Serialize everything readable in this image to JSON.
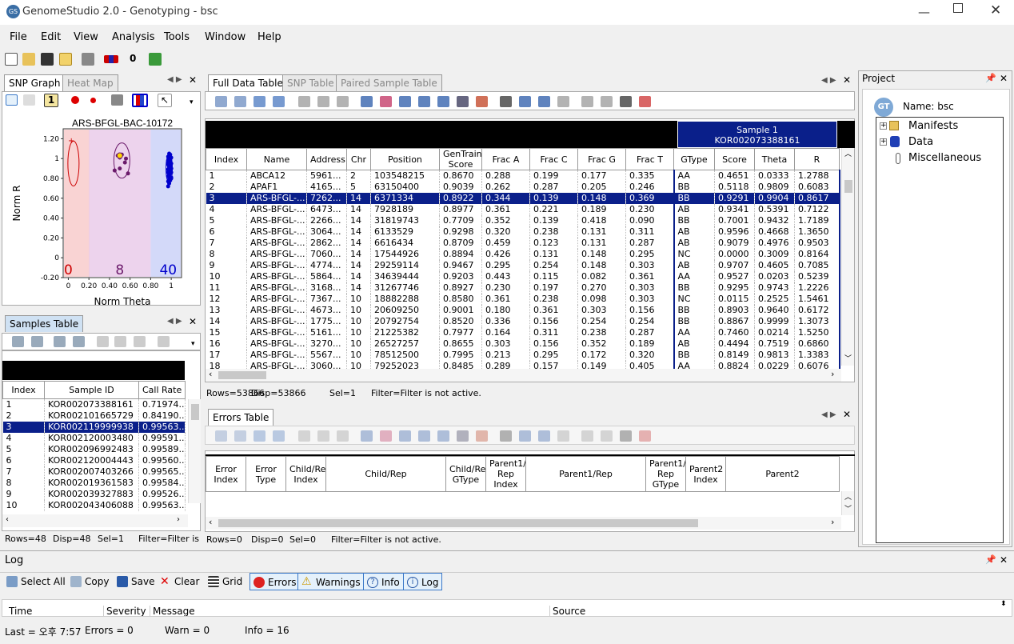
{
  "app": {
    "title": "GenomeStudio 2.0 - Genotyping - bsc",
    "logo": "GS"
  },
  "menu": [
    "File",
    "Edit",
    "View",
    "Analysis",
    "Tools",
    "Window",
    "Help"
  ],
  "toolbar_zero": "0",
  "snp_panel": {
    "tabs": [
      "SNP Graph",
      "Heat Map"
    ],
    "one": "1",
    "chart_title": "ARS-BFGL-BAC-10172",
    "xlabel": "Norm Theta",
    "ylabel": "Norm R",
    "counts": [
      "0",
      "8",
      "40"
    ]
  },
  "chart_data": {
    "type": "scatter",
    "title": "ARS-BFGL-BAC-10172",
    "xlabel": "Norm Theta",
    "ylabel": "Norm R",
    "ylim": [
      -0.2,
      1.3
    ],
    "xlim": [
      -0.05,
      1.1
    ],
    "xticks": [
      "0",
      "0.20",
      "0.40",
      "0.60",
      "0.80",
      "1"
    ],
    "yticks": [
      "1.20",
      "1",
      "0.80",
      "0.60",
      "0.40",
      "0.20",
      "0",
      "-0.20"
    ],
    "cluster_counts": {
      "AA": 0,
      "AB": 8,
      "BB": 40
    },
    "series": [
      {
        "name": "AB",
        "x": [
          0.48,
          0.5,
          0.52,
          0.55,
          0.58,
          0.45,
          0.56,
          0.5
        ],
        "y": [
          1.03,
          1.01,
          1.04,
          0.96,
          0.85,
          0.88,
          1.0,
          0.9
        ]
      },
      {
        "name": "BB",
        "x": [
          0.97,
          0.98,
          0.99,
          1.0,
          0.97,
          0.98,
          0.99,
          1.0,
          0.98,
          0.99,
          0.97,
          1.0,
          0.98,
          0.99,
          0.98,
          0.97,
          1.0,
          0.99,
          0.98,
          0.97,
          0.99,
          0.98,
          1.0,
          0.97,
          0.98,
          0.99,
          0.98,
          0.97,
          0.99,
          1.0,
          0.98,
          0.99,
          0.97,
          0.98,
          0.99,
          1.0,
          0.98,
          0.97,
          0.99,
          0.98
        ],
        "y": [
          0.72,
          0.75,
          0.78,
          0.8,
          0.82,
          0.84,
          0.85,
          0.86,
          0.87,
          0.88,
          0.89,
          0.9,
          0.91,
          0.92,
          0.93,
          0.94,
          0.95,
          0.96,
          0.97,
          0.98,
          0.99,
          1.0,
          1.01,
          1.02,
          1.03,
          1.04,
          0.83,
          0.86,
          0.88,
          0.9,
          0.92,
          0.94,
          0.96,
          0.98,
          1.0,
          0.81,
          0.79,
          0.77,
          0.95,
          1.05
        ]
      }
    ]
  },
  "samples_panel": {
    "tab": "Samples Table",
    "columns": [
      "Index",
      "Sample ID",
      "Call Rate"
    ],
    "rows": [
      [
        "1",
        "KOR002073388161",
        "0.71974..."
      ],
      [
        "2",
        "KOR002101665729",
        "0.84190..."
      ],
      [
        "3",
        "KOR002119999938",
        "0.99563..."
      ],
      [
        "4",
        "KOR002120003480",
        "0.99591..."
      ],
      [
        "5",
        "KOR002096992483",
        "0.99589..."
      ],
      [
        "6",
        "KOR002120004443",
        "0.99560..."
      ],
      [
        "7",
        "KOR002007403266",
        "0.99565..."
      ],
      [
        "8",
        "KOR002019361583",
        "0.99584..."
      ],
      [
        "9",
        "KOR002039327883",
        "0.99526..."
      ],
      [
        "10",
        "KOR002043406088",
        "0.99563..."
      ]
    ],
    "status": [
      "Rows=48",
      "Disp=48",
      "Sel=1",
      "Filter=Filter is not"
    ]
  },
  "full_panel": {
    "tabs": [
      "Full Data Table",
      "SNP Table",
      "Paired Sample Table"
    ],
    "sample_header": "Sample 1",
    "sample_id": "KOR002073388161",
    "columns": [
      "Index",
      "Name",
      "Address",
      "Chr",
      "Position",
      "GenTrain Score",
      "Frac A",
      "Frac C",
      "Frac G",
      "Frac T",
      "GType",
      "Score",
      "Theta",
      "R"
    ],
    "rows": [
      [
        "1",
        "ABCA12",
        "5961...",
        "2",
        "103548215",
        "0.8670",
        "0.288",
        "0.199",
        "0.177",
        "0.335",
        "AA",
        "0.4651",
        "0.0333",
        "1.2788"
      ],
      [
        "2",
        "APAF1",
        "4165...",
        "5",
        "63150400",
        "0.9039",
        "0.262",
        "0.287",
        "0.205",
        "0.246",
        "BB",
        "0.5118",
        "0.9809",
        "0.6083"
      ],
      [
        "3",
        "ARS-BFGL-...",
        "7262...",
        "14",
        "6371334",
        "0.8922",
        "0.344",
        "0.139",
        "0.148",
        "0.369",
        "BB",
        "0.9291",
        "0.9904",
        "0.8617"
      ],
      [
        "4",
        "ARS-BFGL-...",
        "6473...",
        "14",
        "7928189",
        "0.8977",
        "0.361",
        "0.221",
        "0.189",
        "0.230",
        "AB",
        "0.9341",
        "0.5391",
        "0.7122"
      ],
      [
        "5",
        "ARS-BFGL-...",
        "2266...",
        "14",
        "31819743",
        "0.7709",
        "0.352",
        "0.139",
        "0.418",
        "0.090",
        "BB",
        "0.7001",
        "0.9432",
        "1.7189"
      ],
      [
        "6",
        "ARS-BFGL-...",
        "3064...",
        "14",
        "6133529",
        "0.9298",
        "0.320",
        "0.238",
        "0.131",
        "0.311",
        "AB",
        "0.9596",
        "0.4668",
        "1.3650"
      ],
      [
        "7",
        "ARS-BFGL-...",
        "2862...",
        "14",
        "6616434",
        "0.8709",
        "0.459",
        "0.123",
        "0.131",
        "0.287",
        "AB",
        "0.9079",
        "0.4976",
        "0.9503"
      ],
      [
        "8",
        "ARS-BFGL-...",
        "7060...",
        "14",
        "17544926",
        "0.8894",
        "0.426",
        "0.131",
        "0.148",
        "0.295",
        "NC",
        "0.0000",
        "0.3009",
        "0.8164"
      ],
      [
        "9",
        "ARS-BFGL-...",
        "4774...",
        "14",
        "29259114",
        "0.9467",
        "0.295",
        "0.254",
        "0.148",
        "0.303",
        "AB",
        "0.9707",
        "0.4605",
        "0.7085"
      ],
      [
        "10",
        "ARS-BFGL-...",
        "5864...",
        "14",
        "34639444",
        "0.9203",
        "0.443",
        "0.115",
        "0.082",
        "0.361",
        "AA",
        "0.9527",
        "0.0203",
        "0.5239"
      ],
      [
        "11",
        "ARS-BFGL-...",
        "3168...",
        "14",
        "31267746",
        "0.8927",
        "0.230",
        "0.197",
        "0.270",
        "0.303",
        "BB",
        "0.9295",
        "0.9743",
        "1.2226"
      ],
      [
        "12",
        "ARS-BFGL-...",
        "7367...",
        "10",
        "18882288",
        "0.8580",
        "0.361",
        "0.238",
        "0.098",
        "0.303",
        "NC",
        "0.0115",
        "0.2525",
        "1.5461"
      ],
      [
        "13",
        "ARS-BFGL-...",
        "4673...",
        "10",
        "20609250",
        "0.9001",
        "0.180",
        "0.361",
        "0.303",
        "0.156",
        "BB",
        "0.8903",
        "0.9640",
        "0.6172"
      ],
      [
        "14",
        "ARS-BFGL-...",
        "1775...",
        "10",
        "20792754",
        "0.8520",
        "0.336",
        "0.156",
        "0.254",
        "0.254",
        "BB",
        "0.8867",
        "0.9999",
        "1.3073"
      ],
      [
        "15",
        "ARS-BFGL-...",
        "5161...",
        "10",
        "21225382",
        "0.7977",
        "0.164",
        "0.311",
        "0.238",
        "0.287",
        "AA",
        "0.7460",
        "0.0214",
        "1.5250"
      ],
      [
        "16",
        "ARS-BFGL-...",
        "3270...",
        "10",
        "26527257",
        "0.8655",
        "0.303",
        "0.156",
        "0.352",
        "0.189",
        "AB",
        "0.4494",
        "0.7519",
        "0.6860"
      ],
      [
        "17",
        "ARS-BFGL-...",
        "5567...",
        "10",
        "78512500",
        "0.7995",
        "0.213",
        "0.295",
        "0.172",
        "0.320",
        "BB",
        "0.8149",
        "0.9813",
        "1.3383"
      ],
      [
        "18",
        "ARS-BFGL-...",
        "3060...",
        "10",
        "79252023",
        "0.8485",
        "0.289",
        "0.157",
        "0.149",
        "0.405",
        "AA",
        "0.8824",
        "0.0229",
        "0.6076"
      ]
    ],
    "status": [
      "Rows=53866",
      "Disp=53866",
      "Sel=1",
      "Filter=Filter is not active."
    ]
  },
  "errors_panel": {
    "tab": "Errors Table",
    "columns": [
      "Error Index",
      "Error Type",
      "Child/Rep Index",
      "Child/Rep",
      "Child/Rep GType",
      "Parent1/ Rep Index",
      "Parent1/Rep",
      "Parent1/ Rep GType",
      "Parent2 Index",
      "Parent2"
    ],
    "status": [
      "Rows=0",
      "Disp=0",
      "Sel=0",
      "Filter=Filter is not active."
    ]
  },
  "project": {
    "title": "Project",
    "badge": "GT",
    "name": "Name: bsc",
    "items": [
      "Manifests",
      "Data",
      "Miscellaneous"
    ]
  },
  "log": {
    "title": "Log",
    "buttons": [
      "Select All",
      "Copy",
      "Save",
      "Clear",
      "Grid",
      "Errors",
      "Warnings",
      "Info",
      "Log"
    ],
    "columns": [
      "Time",
      "Severity",
      "Message",
      "Source"
    ],
    "status": [
      "Last = 오후 7:57",
      "Errors = 0",
      "Warn = 0",
      "Info = 16"
    ]
  },
  "colors": {
    "selection": "#0a1f8a",
    "accent": "#3a78c8"
  }
}
